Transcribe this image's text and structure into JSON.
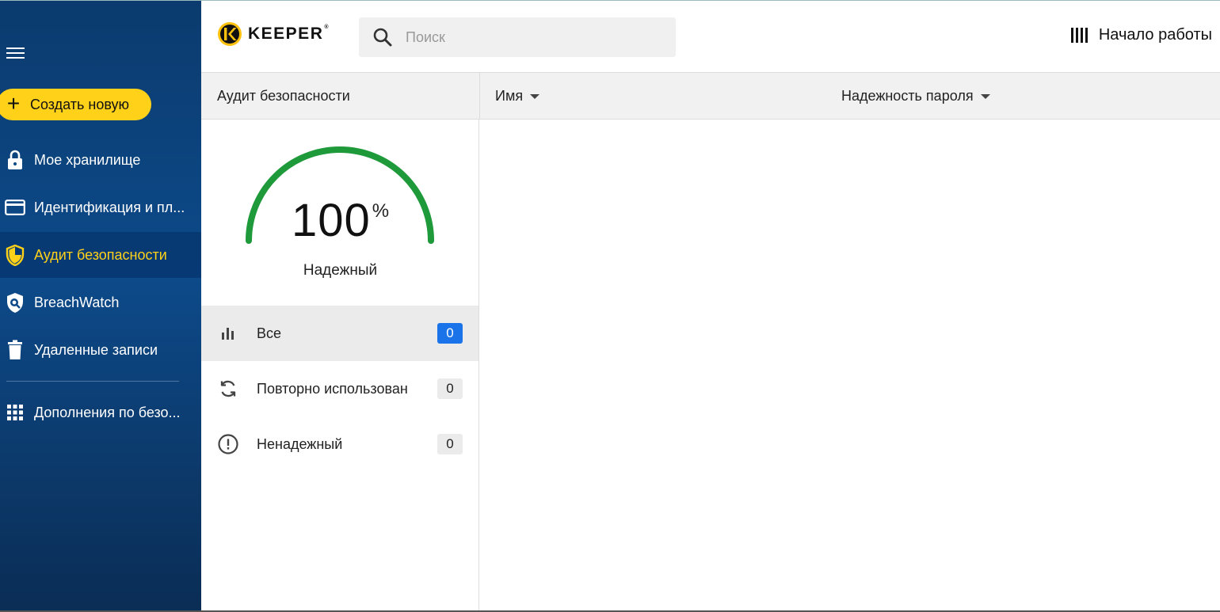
{
  "sidebar": {
    "create_label": "Создать новую",
    "items": [
      {
        "label": "Мое хранилище",
        "icon": "lock-icon"
      },
      {
        "label": "Идентификация и пл...",
        "icon": "credit-card-icon"
      },
      {
        "label": "Аудит безопасности",
        "icon": "shield-icon",
        "active": true
      },
      {
        "label": "BreachWatch",
        "icon": "breachwatch-icon"
      },
      {
        "label": "Удаленные записи",
        "icon": "trash-icon"
      },
      {
        "label": "Дополнения по безо...",
        "icon": "grid-icon"
      }
    ]
  },
  "header": {
    "logo_text": "KEEPER",
    "logo_mark": "®",
    "search_placeholder": "Поиск",
    "start_label": "Начало работы"
  },
  "audit": {
    "title": "Аудит безопасности",
    "score": "100",
    "score_unit": "%",
    "score_fraction": 1.0,
    "status": "Надежный",
    "gauge_color": "#1f9a3a",
    "filters": [
      {
        "label": "Все",
        "count": "0",
        "icon": "bar-chart-icon",
        "active": true
      },
      {
        "label": "Повторно использован",
        "count": "0",
        "icon": "sync-icon"
      },
      {
        "label": "Ненадежный",
        "count": "0",
        "icon": "alert-circle-icon"
      }
    ]
  },
  "table": {
    "columns": [
      {
        "label": "Имя"
      },
      {
        "label": "Надежность пароля"
      }
    ]
  },
  "colors": {
    "accent": "#ffd119",
    "sidebar": "#0d4a8a",
    "badge_active": "#1a73e8"
  }
}
